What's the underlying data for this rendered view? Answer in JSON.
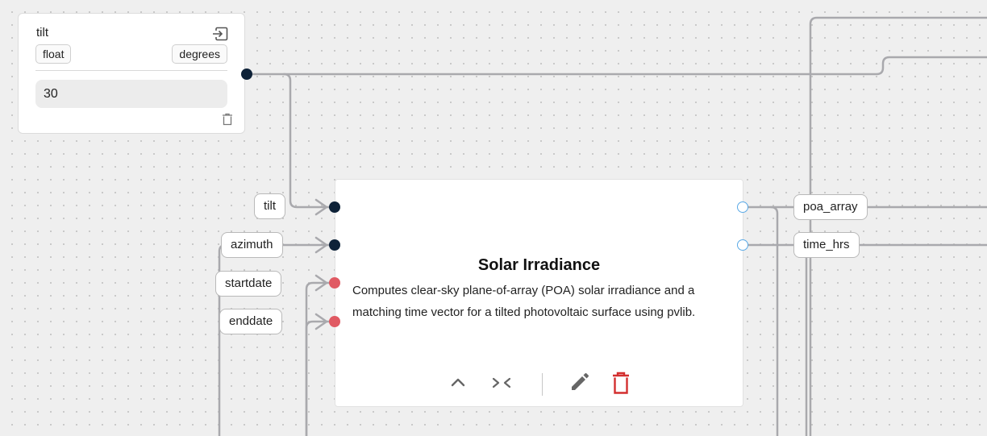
{
  "input_node": {
    "title": "tilt",
    "type": "float",
    "unit": "degrees",
    "value": "30",
    "icons": [
      "export-icon",
      "trash-icon"
    ]
  },
  "main_node": {
    "title": "Solar Irradiance",
    "description": "Computes clear-sky plane-of-array (POA) solar irradiance and a matching time vector for a tilted photovoltaic surface using pvlib.",
    "inputs": [
      {
        "label": "tilt",
        "connected": true
      },
      {
        "label": "azimuth",
        "connected": true
      },
      {
        "label": "startdate",
        "connected": false
      },
      {
        "label": "enddate",
        "connected": false
      }
    ],
    "outputs": [
      {
        "label": "poa_array"
      },
      {
        "label": "time_hrs"
      }
    ],
    "toolbar_icons": [
      "collapse-icon",
      "shrink-icon",
      "edit-icon",
      "delete-icon"
    ]
  },
  "colors": {
    "connected_port": "#0e2238",
    "required_port": "#e05a63",
    "output_port": "#5aa9e6",
    "wire": "#a9a9ad",
    "delete": "#d32f2f"
  }
}
